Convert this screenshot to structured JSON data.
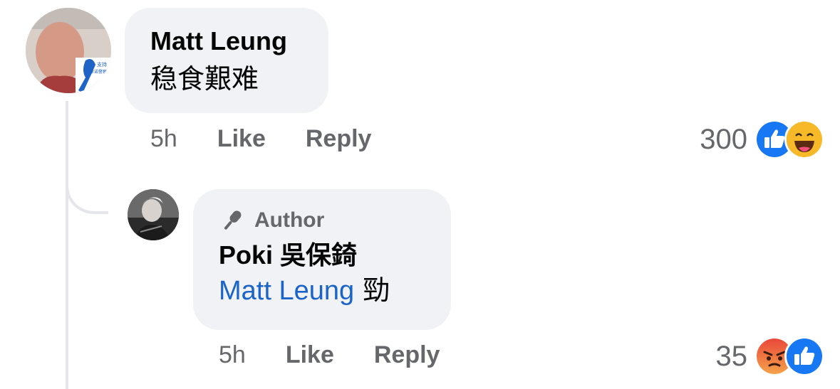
{
  "comment": {
    "author": "Matt Leung",
    "text": "稳食艱难",
    "time": "5h",
    "like_label": "Like",
    "reply_label": "Reply",
    "reaction_count": "300",
    "reactions": [
      "like-icon",
      "haha-icon"
    ],
    "avatar_badge_text": "支持 休诺警察"
  },
  "reply": {
    "badge": "Author",
    "author": "Poki 吳保錡",
    "mention": "Matt Leung",
    "text": "勁",
    "time": "5h",
    "like_label": "Like",
    "reply_label": "Reply",
    "reaction_count": "35",
    "reactions": [
      "angry-icon",
      "like-icon"
    ]
  },
  "colors": {
    "bubble": "#f0f2f5",
    "mention": "#1a63c9",
    "meta": "#65676b",
    "like_blue": "#1877f2",
    "haha_yellow": "#f7b928",
    "angry_red": "#e9710f"
  }
}
